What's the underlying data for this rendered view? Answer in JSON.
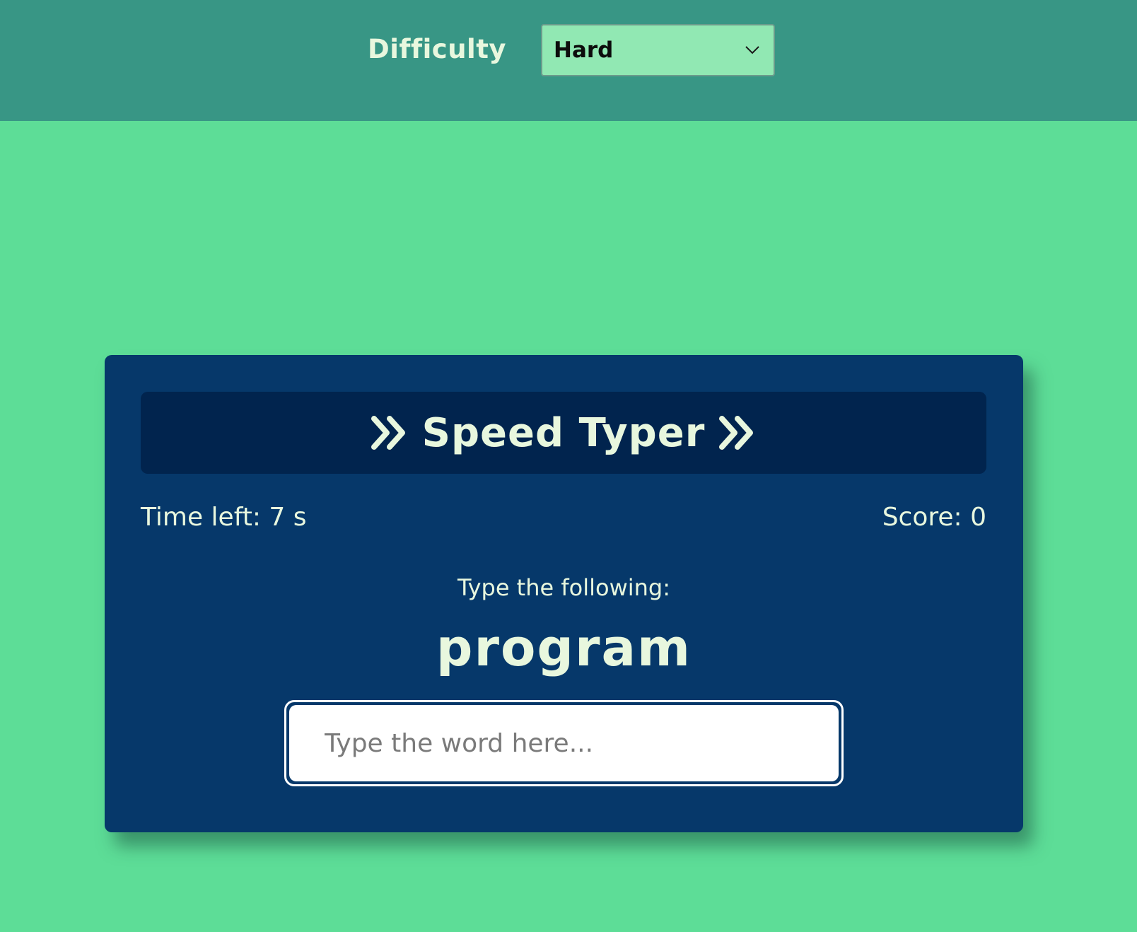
{
  "header": {
    "difficulty_label": "Difficulty",
    "difficulty_selected": "Hard",
    "colors": {
      "bar": "#389685",
      "select_bg": "#91e8b3"
    }
  },
  "game": {
    "title": "Speed Typer",
    "title_icon": "double-chevron-right-icon",
    "time_left": "Time left: 7 s",
    "score": "Score: 0",
    "prompt": "Type the following:",
    "word": "program",
    "input_placeholder": "Type the word here...",
    "input_value": "",
    "colors": {
      "card": "#06386a",
      "title_box": "#01244e",
      "text": "#e8f7de",
      "page_bg": "#5ddd97"
    }
  }
}
